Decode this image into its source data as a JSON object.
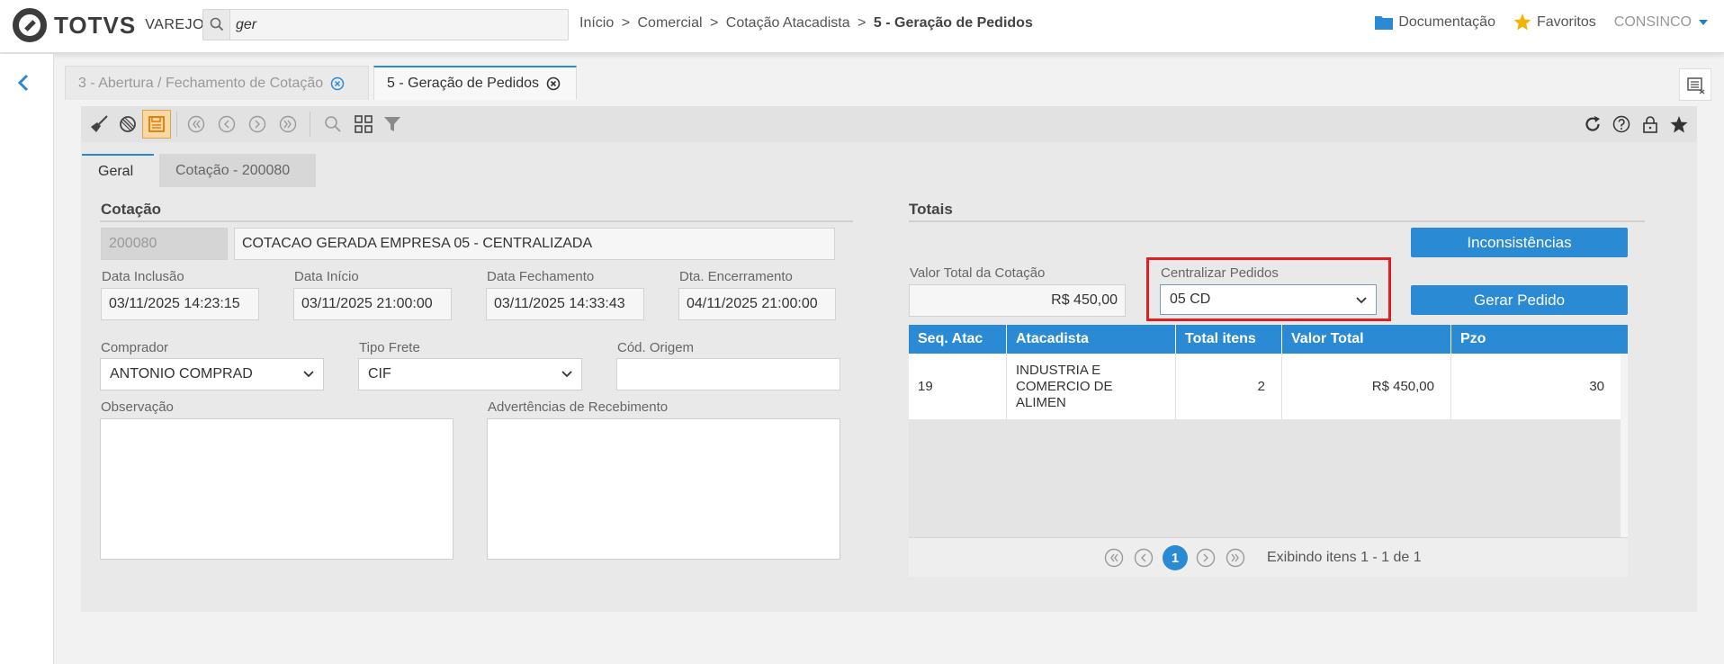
{
  "header": {
    "brand": "TOTVS",
    "brand_sub": "VAREJO",
    "search_value": "ger",
    "breadcrumb": [
      "Início",
      "Comercial",
      "Cotação Atacadista"
    ],
    "breadcrumb_current": "5 - Geração de Pedidos",
    "breadcrumb_sep": ">",
    "links": {
      "documentation": "Documentação",
      "favorites": "Favoritos"
    },
    "user": "CONSINCO",
    "accent_color": "#2a8ad4",
    "favorites_color": "#f5b301"
  },
  "window_tabs": [
    {
      "label": "3 - Abertura / Fechamento de Cotação",
      "active": false
    },
    {
      "label": "5 - Geração de Pedidos",
      "active": true
    }
  ],
  "toolbar": {
    "left_icons": [
      "broom-icon",
      "cancel-icon",
      "save-icon",
      "first-icon",
      "prev-icon",
      "next-icon",
      "last-icon",
      "search-icon",
      "grid-icon",
      "filter-icon"
    ],
    "right_icons": [
      "refresh-icon",
      "help-icon",
      "lock-icon",
      "star-icon"
    ]
  },
  "inner_tabs": [
    {
      "label": "Geral",
      "active": true
    },
    {
      "label": "Cotação - 200080",
      "active": false
    }
  ],
  "cotacao": {
    "section_title": "Cotação",
    "code": "200080",
    "description": "COTACAO GERADA EMPRESA 05 - CENTRALIZADA",
    "data_inclusao": {
      "label": "Data Inclusão",
      "value": "03/11/2025 14:23:15"
    },
    "data_inicio": {
      "label": "Data Início",
      "value": "03/11/2025 21:00:00"
    },
    "data_fechamento": {
      "label": "Data Fechamento",
      "value": "03/11/2025 14:33:43"
    },
    "dta_encerramento": {
      "label": "Dta. Encerramento",
      "value": "04/11/2025 21:00:00"
    },
    "comprador": {
      "label": "Comprador",
      "value": "ANTONIO COMPRAD"
    },
    "tipo_frete": {
      "label": "Tipo Frete",
      "value": "CIF"
    },
    "cod_origem": {
      "label": "Cód. Origem",
      "value": ""
    },
    "observacao": {
      "label": "Observação",
      "value": ""
    },
    "advertencias": {
      "label": "Advertências de Recebimento",
      "value": ""
    }
  },
  "totais": {
    "section_title": "Totais",
    "inconsistencias_button": "Inconsistências",
    "gerar_pedido_button": "Gerar Pedido",
    "valor_total": {
      "label": "Valor Total da Cotação",
      "value": "R$ 450,00"
    },
    "centralizar": {
      "label": "Centralizar Pedidos",
      "value": "05 CD"
    },
    "grid": {
      "columns": [
        "Seq. Atac",
        "Atacadista",
        "Total itens",
        "Valor Total",
        "Pzo"
      ],
      "rows": [
        {
          "seq": "19",
          "atacadista": "INDUSTRIA E COMERCIO DE ALIMEN",
          "total_itens": "2",
          "valor_total": "R$ 450,00",
          "pzo": "30"
        }
      ]
    },
    "pager": {
      "current_page": "1",
      "info": "Exibindo itens 1 - 1 de 1"
    }
  }
}
